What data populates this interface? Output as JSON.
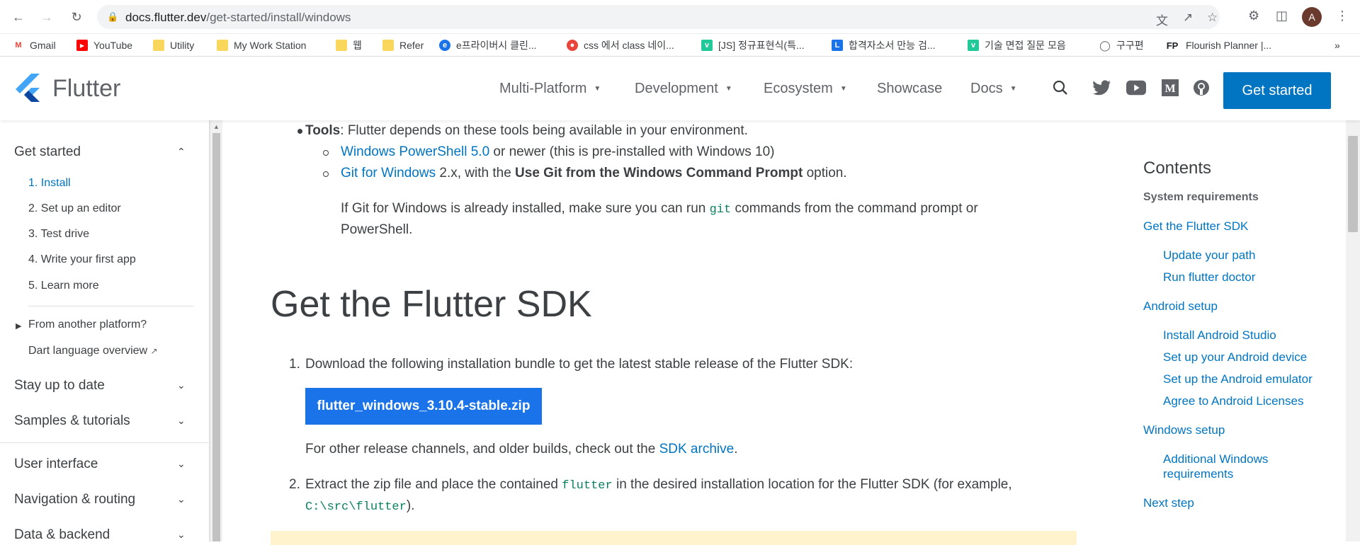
{
  "browser": {
    "url_host": "docs.flutter.dev",
    "url_path": "/get-started/install/windows",
    "avatar_letter": "A",
    "bookmarks": [
      {
        "label": "Gmail",
        "icon": "gmail-icon"
      },
      {
        "label": "YouTube",
        "icon": "youtube-icon"
      },
      {
        "label": "Utility",
        "icon": "folder-icon"
      },
      {
        "label": "My Work Station",
        "icon": "folder-icon"
      },
      {
        "label": "웹",
        "icon": "folder-icon"
      },
      {
        "label": "Refer",
        "icon": "folder-icon"
      },
      {
        "label": "e프라이버시 클린...",
        "icon": "eprivacy-icon"
      },
      {
        "label": "css 에서 class 네이...",
        "icon": "site-icon"
      },
      {
        "label": "[JS] 정규표현식(특...",
        "icon": "velog-icon"
      },
      {
        "label": "합격자소서 만능 검...",
        "icon": "l-icon"
      },
      {
        "label": "기술 면접 질문 모음",
        "icon": "velog-icon"
      },
      {
        "label": "구구편",
        "icon": "globe-icon"
      },
      {
        "label": "Flourish Planner |...",
        "icon": "fp-icon"
      }
    ],
    "bookmarks_overflow": "»"
  },
  "header": {
    "logo_text": "Flutter",
    "nav": [
      {
        "label": "Multi-Platform",
        "dropdown": true
      },
      {
        "label": "Development",
        "dropdown": true
      },
      {
        "label": "Ecosystem",
        "dropdown": true
      },
      {
        "label": "Showcase",
        "dropdown": false
      },
      {
        "label": "Docs",
        "dropdown": true
      }
    ],
    "cta": "Get started"
  },
  "sidebar": {
    "section": "Get started",
    "steps": [
      "1. Install",
      "2. Set up an editor",
      "3. Test drive",
      "4. Write your first app",
      "5. Learn more"
    ],
    "from_another": "From another platform?",
    "dart_overview": "Dart language overview",
    "groups": [
      "Stay up to date",
      "Samples & tutorials",
      "User interface",
      "Navigation & routing",
      "Data & backend"
    ]
  },
  "content": {
    "tools_label": "Tools",
    "tools_text": ": Flutter depends on these tools being available in your environment.",
    "powershell_link": "Windows PowerShell 5.0",
    "powershell_text": " or newer (this is pre-installed with Windows 10)",
    "git_link": "Git for Windows",
    "git_text_1": " 2.x, with the ",
    "git_bold": "Use Git from the Windows Command Prompt",
    "git_text_2": " option.",
    "git_note_1": "If Git for Windows is already installed, make sure you can run ",
    "git_note_code": "git",
    "git_note_2": " commands from the command prompt or",
    "git_note_3": "PowerShell.",
    "heading": "Get the Flutter SDK",
    "step1_num": "1.",
    "step1": "Download the following installation bundle to get the latest stable release of the Flutter SDK:",
    "download_button": "flutter_windows_3.10.4-stable.zip",
    "other_1": "For other release channels, and older builds, check out the ",
    "other_link": "SDK archive",
    "other_2": ".",
    "step2_num": "2.",
    "step2_a": "Extract the zip file and place the contained ",
    "step2_code": "flutter",
    "step2_b": " in the desired installation location for the Flutter SDK (for example,",
    "step2_path": "C:\\src\\flutter",
    "step2_end": ")."
  },
  "toc": {
    "title": "Contents",
    "items": [
      {
        "label": "System requirements",
        "level": 1,
        "current": true
      },
      {
        "label": "Get the Flutter SDK",
        "level": 1
      },
      {
        "label": "Update your path",
        "level": 2
      },
      {
        "label": "Run flutter doctor",
        "level": 2
      },
      {
        "label": "Android setup",
        "level": 1
      },
      {
        "label": "Install Android Studio",
        "level": 2
      },
      {
        "label": "Set up your Android device",
        "level": 2
      },
      {
        "label": "Set up the Android emulator",
        "level": 2
      },
      {
        "label": "Agree to Android Licenses",
        "level": 2
      },
      {
        "label": "Windows setup",
        "level": 1
      },
      {
        "label": "Additional Windows",
        "level": 2
      },
      {
        "label": "requirements",
        "level": 2
      },
      {
        "label": "Next step",
        "level": 1
      }
    ]
  },
  "colors": {
    "accent": "#0175c2",
    "button": "#1a73e8",
    "code": "#0c8060",
    "note": "#fef3cd"
  }
}
